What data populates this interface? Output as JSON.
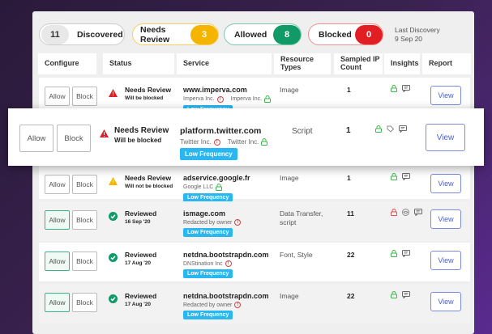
{
  "summary": {
    "discovered": {
      "count": "11",
      "label": "Discovered"
    },
    "needs_review": {
      "label": "Needs Review",
      "count": "3",
      "color": "#f5b400"
    },
    "allowed": {
      "label": "Allowed",
      "count": "8",
      "color": "#109a68"
    },
    "blocked": {
      "label": "Blocked",
      "count": "0",
      "color": "#e01e24"
    },
    "last_discovery_label": "Last Discovery",
    "last_discovery_date": "9 Sep 20"
  },
  "columns": [
    "Configure",
    "Status",
    "Service",
    "Resource Types",
    "Sampled IP Count",
    "Insights",
    "Report"
  ],
  "allow_label": "Allow",
  "block_label": "Block",
  "view_label": "View",
  "tag_label": "Low Frequency",
  "rows": [
    {
      "status": "Needs Review",
      "status_sub": "Will be blocked",
      "status_icon": "warning-red",
      "service": "www.imperva.com",
      "owner": "Imperva Inc.",
      "owner2": "Imperva Inc.",
      "resource": "Image",
      "count": "1",
      "allowed": false
    },
    {
      "status": "Needs Review",
      "status_sub": "Will be blocked",
      "status_icon": "warning-red",
      "service": "platform.twitter.com",
      "owner": "Twitter Inc.",
      "owner2": "Twitter Inc.",
      "resource": "Script",
      "count": "1",
      "allowed": false
    },
    {
      "status": "Needs Review",
      "status_sub": "Will not be blocked",
      "status_icon": "warning-yellow",
      "service": "adservice.google.fr",
      "owner": "Google LLC",
      "resource": "Image",
      "count": "1",
      "allowed": false
    },
    {
      "status": "Reviewed",
      "status_sub": "16 Sep '20",
      "status_icon": "check-green",
      "service": "ismage.com",
      "owner": "Redacted by owner",
      "resource": "Data Transfer, script",
      "count": "11",
      "allowed": true
    },
    {
      "status": "Reviewed",
      "status_sub": "17 Aug '20",
      "status_icon": "check-green",
      "service": "netdna.bootstrapdn.com",
      "owner": "DNStination Inc",
      "resource": "Font, Style",
      "count": "22",
      "allowed": true
    },
    {
      "status": "Reviewed",
      "status_sub": "17 Aug '20",
      "status_icon": "check-green",
      "service": "netdna.bootstrapdn.com",
      "owner": "Redacted by owner",
      "resource": "Image",
      "count": "22",
      "allowed": true
    }
  ]
}
